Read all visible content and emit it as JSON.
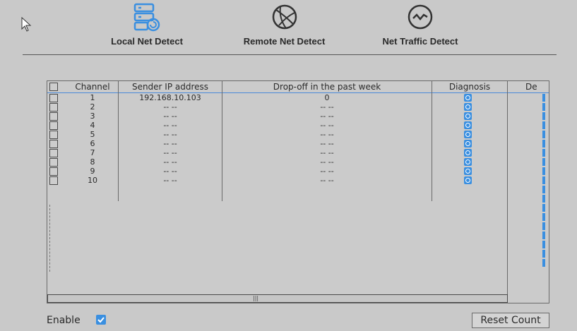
{
  "tabs": [
    {
      "label": "Local Net Detect",
      "icon": "local-net-icon"
    },
    {
      "label": "Remote Net Detect",
      "icon": "globe-icon"
    },
    {
      "label": "Net Traffic Detect",
      "icon": "traffic-wave-icon"
    }
  ],
  "table": {
    "headers": {
      "channel": "Channel",
      "sender_ip": "Sender IP address",
      "dropoff": "Drop-off in the past week",
      "diagnosis": "Diagnosis",
      "details": "De"
    },
    "rows": [
      {
        "channel": "1",
        "ip": "192.168.10.103",
        "dropoff": "0"
      },
      {
        "channel": "2",
        "ip": "-- --",
        "dropoff": "-- --"
      },
      {
        "channel": "3",
        "ip": "-- --",
        "dropoff": "-- --"
      },
      {
        "channel": "4",
        "ip": "-- --",
        "dropoff": "-- --"
      },
      {
        "channel": "5",
        "ip": "-- --",
        "dropoff": "-- --"
      },
      {
        "channel": "6",
        "ip": "-- --",
        "dropoff": "-- --"
      },
      {
        "channel": "7",
        "ip": "-- --",
        "dropoff": "-- --"
      },
      {
        "channel": "8",
        "ip": "-- --",
        "dropoff": "-- --"
      },
      {
        "channel": "9",
        "ip": "-- --",
        "dropoff": "-- --"
      },
      {
        "channel": "10",
        "ip": "-- --",
        "dropoff": "-- --"
      }
    ]
  },
  "footer": {
    "enable_label": "Enable",
    "enable_checked": true,
    "reset_label": "Reset Count"
  },
  "colors": {
    "accent": "#3a8fe0",
    "background": "#c9c9c9"
  }
}
